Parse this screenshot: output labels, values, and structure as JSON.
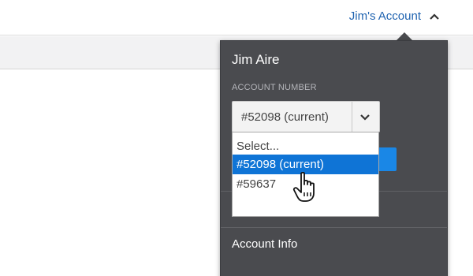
{
  "header": {
    "account_label": "Jim's Account"
  },
  "panel": {
    "user_name": "Jim Aire",
    "account_number_label": "ACCOUNT NUMBER",
    "selected_account": "#52098 (current)",
    "options": [
      {
        "label": "Select..."
      },
      {
        "label": "#52098 (current)"
      },
      {
        "label": "#59637"
      }
    ],
    "account_info_label": "Account Info"
  },
  "colors": {
    "link_blue": "#1f63b0",
    "panel_bg": "#4a4b4f",
    "highlight": "#0f74d6",
    "button_blue": "#1a87e6"
  }
}
